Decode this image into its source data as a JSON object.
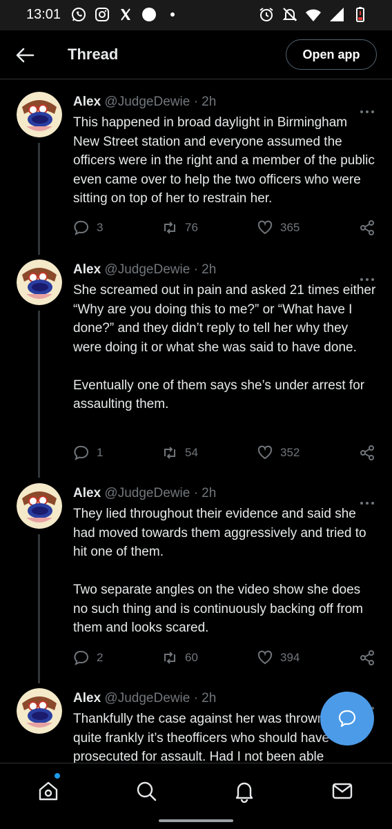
{
  "status_bar": {
    "time": "13:01",
    "left_icons": [
      "whatsapp-icon",
      "instagram-icon",
      "x-icon",
      "circle-icon",
      "dot-icon"
    ],
    "right_icons": [
      "alarm-icon",
      "mute-icon",
      "wifi-icon",
      "signal-icon",
      "battery-low-icon"
    ]
  },
  "header": {
    "title": "Thread",
    "open_app_label": "Open app"
  },
  "colors": {
    "background": "#000000",
    "accent": "#1d9bf0",
    "fab": "#4c9be8",
    "muted": "#71767b",
    "text": "#e7e9ea"
  },
  "tweets": [
    {
      "name": "Alex",
      "handle": "@JudgeDewie",
      "separator": "·",
      "time": "2h",
      "paragraphs": [
        "This happened in broad daylight in Birmingham New Street station and everyone assumed the officers were in the right and a member of the public even came over to help the two officers who were sitting on top of her to restrain her."
      ],
      "replies": "3",
      "retweets": "76",
      "likes": "365"
    },
    {
      "name": "Alex",
      "handle": "@JudgeDewie",
      "separator": "·",
      "time": "2h",
      "paragraphs": [
        "She screamed out in pain and asked 21 times either “Why are you doing this to me?” or “What have I done?” and they didn’t reply to tell her why they were doing it or what she was said to have done.",
        "Eventually one of them says she’s under arrest for assaulting them."
      ],
      "replies": "1",
      "retweets": "54",
      "likes": "352"
    },
    {
      "name": "Alex",
      "handle": "@JudgeDewie",
      "separator": "·",
      "time": "2h",
      "paragraphs": [
        "They lied throughout their evidence and said she had moved towards them aggressively and tried to hit one of them.",
        "Two separate angles on the video show she does no such thing and is continuously backing off from them and looks scared."
      ],
      "replies": "2",
      "retweets": "60",
      "likes": "394"
    },
    {
      "name": "Alex",
      "handle": "@JudgeDewie",
      "separator": "·",
      "time": "2h",
      "paragraphs": [
        "Thankfully the case against her was thrown out but quite frankly it’s theofficers who should have been prosecuted for assault. Had I not been able"
      ]
    }
  ],
  "bottom_nav": [
    "home-icon",
    "search-icon",
    "notifications-icon",
    "messages-icon"
  ]
}
